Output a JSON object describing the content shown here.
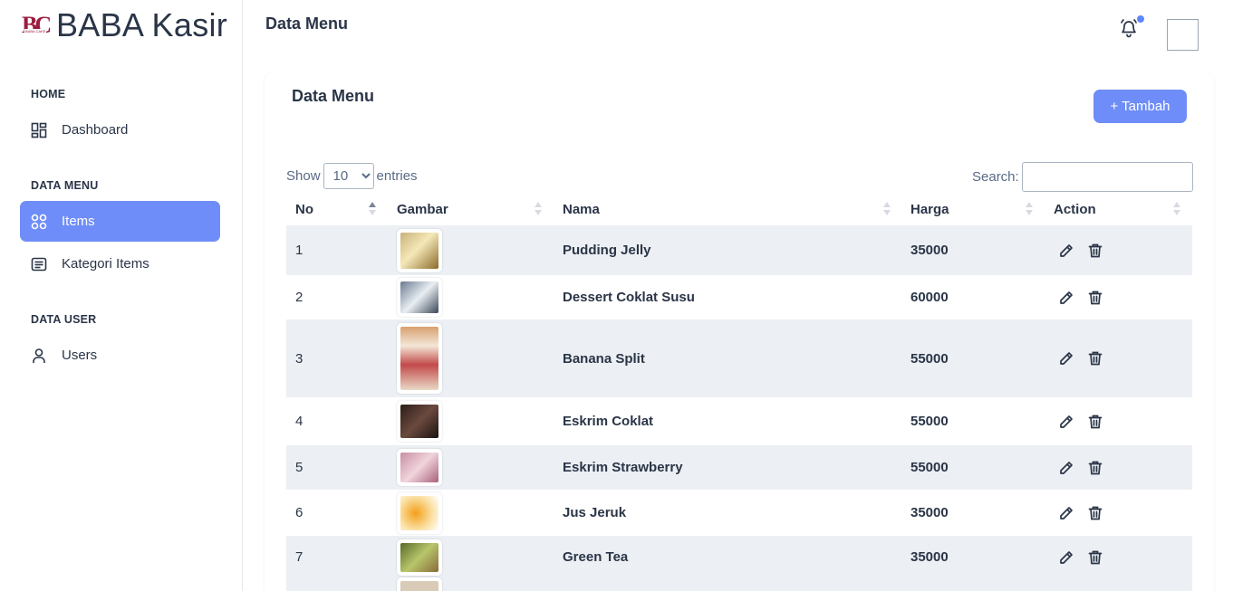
{
  "brand": {
    "logo_text": "BC",
    "logo_sub": "BABA CAKE",
    "name": "BABA Kasir"
  },
  "sidebar": {
    "sections": [
      "HOME",
      "DATA MENU",
      "DATA USER"
    ],
    "items": [
      {
        "label": "Dashboard",
        "icon": "layout-dashboard-icon"
      },
      {
        "label": "Items",
        "icon": "apps-icon"
      },
      {
        "label": "Kategori Items",
        "icon": "list-details-icon"
      },
      {
        "label": "Users",
        "icon": "user-icon"
      }
    ]
  },
  "header": {
    "title": "Data Menu"
  },
  "card": {
    "title": "Data Menu",
    "add_button": "+ Tambah",
    "show_label": "Show",
    "show_value": "10",
    "entries_label": "entries",
    "search_label": "Search:"
  },
  "table": {
    "columns": [
      "No",
      "Gambar",
      "Nama",
      "Harga",
      "Action"
    ],
    "rows": [
      {
        "no": "1",
        "nama": "Pudding Jelly",
        "harga": "35000"
      },
      {
        "no": "2",
        "nama": "Dessert Coklat Susu",
        "harga": "60000"
      },
      {
        "no": "3",
        "nama": "Banana Split",
        "harga": "55000"
      },
      {
        "no": "4",
        "nama": "Eskrim Coklat",
        "harga": "55000"
      },
      {
        "no": "5",
        "nama": "Eskrim Strawberry",
        "harga": "55000"
      },
      {
        "no": "6",
        "nama": "Jus Jeruk",
        "harga": "35000"
      },
      {
        "no": "7",
        "nama": "Green Tea",
        "harga": "35000"
      }
    ]
  },
  "colors": {
    "accent": "#6f8df8",
    "notification_dot": "#5d87ff",
    "brand_logo": "#9b1c3f",
    "row_stripe": "#eceff3"
  }
}
